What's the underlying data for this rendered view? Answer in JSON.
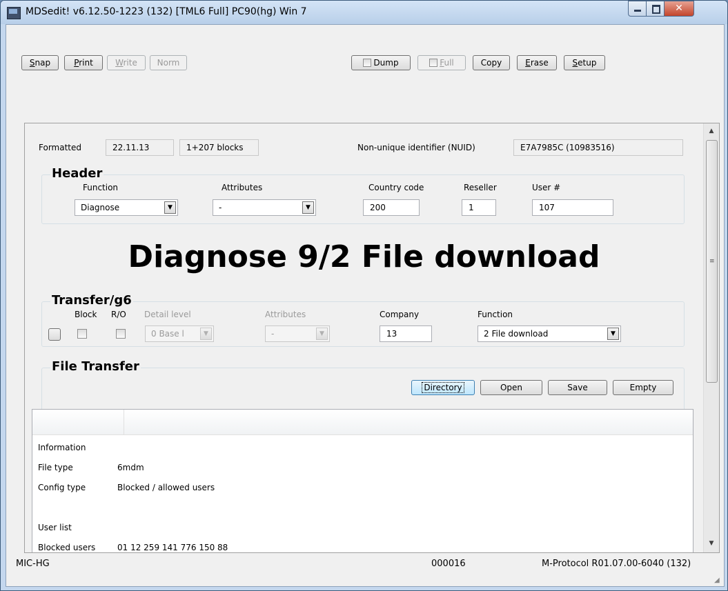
{
  "window": {
    "title": "MDSedit! v6.12.50-1223 (132) [TML6 Full] PC90(hg) Win 7"
  },
  "toolbar": {
    "snap": "Snap",
    "snap_u": "S",
    "snap_rest": "nap",
    "print_u": "P",
    "print_rest": "rint",
    "write_u": "W",
    "write_rest": "rite",
    "norm": "Norm",
    "dump": "Dump",
    "full_u": "F",
    "full_rest": "ull",
    "copy": "Copy",
    "erase_u": "E",
    "erase_rest": "rase",
    "setup_u": "S",
    "setup_rest": "etup"
  },
  "info": {
    "formatted_label": "Formatted",
    "formatted_date": "22.11.13",
    "blocks": "1+207 blocks",
    "nuid_label": "Non-unique identifier (NUID)",
    "nuid_value": "E7A7985C (10983516)"
  },
  "header": {
    "title": "Header",
    "function_label": "Function",
    "function_value": "Diagnose",
    "attributes_label": "Attributes",
    "attributes_value": "-",
    "country_label": "Country code",
    "country_value": "200",
    "reseller_label": "Reseller",
    "reseller_value": "1",
    "user_label": "User #",
    "user_value": "107"
  },
  "headline": "Diagnose 9/2 File download",
  "transfer": {
    "title": "Transfer/g6",
    "block_label": "Block",
    "ro_label": "R/O",
    "detail_label": "Detail level",
    "detail_value": "0 Base l",
    "attributes_label": "Attributes",
    "attributes_value": "-",
    "company_label": "Company",
    "company_value": "13",
    "function_label": "Function",
    "function_value": "2 File download"
  },
  "file_transfer": {
    "title": "File Transfer",
    "directory": "Directory",
    "open": "Open",
    "save": "Save",
    "empty": "Empty",
    "rows": [
      {
        "k": "Information",
        "v": ""
      },
      {
        "k": "File type",
        "v": "6mdm"
      },
      {
        "k": "Config type",
        "v": "Blocked / allowed users"
      },
      {
        "k": "",
        "v": ""
      },
      {
        "k": "User list",
        "v": ""
      },
      {
        "k": "Blocked users",
        "v": "01 12 259 141 776 150 88"
      }
    ]
  },
  "status": {
    "left": "MIC-HG",
    "middle": "000016",
    "right": "M-Protocol R01.07.00-6040 (132)"
  }
}
